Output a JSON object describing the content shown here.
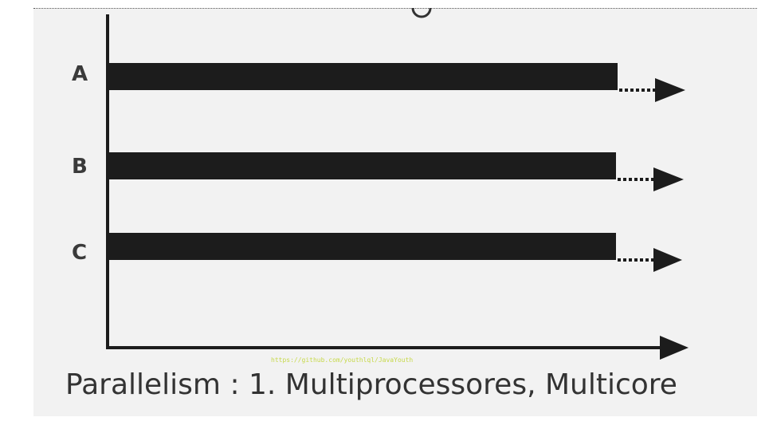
{
  "diagram": {
    "rows": [
      {
        "label": "A"
      },
      {
        "label": "B"
      },
      {
        "label": "C"
      }
    ],
    "caption": "Parallelism : 1. Multiprocessores, Multicore",
    "watermark": "https://github.com/youthlql/JavaYouth",
    "bar_color": "#1c1c1c",
    "axis_color": "#1c1c1c"
  }
}
